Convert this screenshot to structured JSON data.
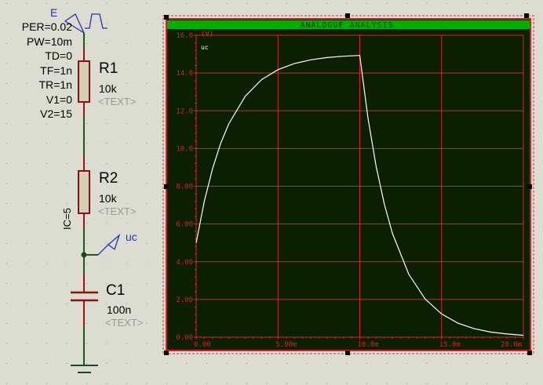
{
  "schematic": {
    "generator": {
      "ref": "E",
      "params": [
        "PER=0.02",
        "PW=10m",
        "TD=0",
        "TF=1n",
        "TR=1n",
        "V1=0",
        "V2=15"
      ]
    },
    "r1": {
      "ref": "R1",
      "value": "10k",
      "text": "<TEXT>"
    },
    "r2": {
      "ref": "R2",
      "value": "10k",
      "text": "<TEXT>"
    },
    "c1": {
      "ref": "C1",
      "value": "100n",
      "text": "<TEXT>",
      "ic": "IC=5"
    },
    "probe": {
      "label": "uc"
    }
  },
  "graph": {
    "title": "ANALOGUE ANALYSIS",
    "title_bar_color": "#00b000",
    "background_color": "#0a2000",
    "grid_color": "#e02020",
    "trace_color": "#ffffff"
  },
  "chart_data": {
    "type": "line",
    "title": "ANALOGUE ANALYSIS",
    "ylabel": "(V)",
    "xlabel": "",
    "xlim": [
      0,
      0.02
    ],
    "ylim": [
      0,
      16
    ],
    "grid": true,
    "x_tick_labels": [
      "0.00",
      "5.00m",
      "10.0m",
      "15.0m",
      "20.0m"
    ],
    "y_tick_labels": [
      "0.00",
      "2.00",
      "4.00",
      "6.00",
      "8.00",
      "10.0",
      "12.0",
      "14.0",
      "16.0"
    ],
    "series": [
      {
        "name": "uc",
        "x": [
          0,
          0.0005,
          0.001,
          0.0015,
          0.002,
          0.003,
          0.004,
          0.005,
          0.006,
          0.007,
          0.008,
          0.009,
          0.01,
          0.0105,
          0.011,
          0.0115,
          0.012,
          0.013,
          0.014,
          0.015,
          0.016,
          0.017,
          0.018,
          0.019,
          0.02
        ],
        "y": [
          5,
          7.21,
          8.93,
          10.28,
          11.32,
          12.77,
          13.65,
          14.18,
          14.5,
          14.7,
          14.82,
          14.89,
          14.93,
          11.63,
          9.06,
          7.05,
          5.49,
          3.33,
          2.02,
          1.23,
          0.74,
          0.45,
          0.27,
          0.17,
          0.1
        ]
      }
    ]
  }
}
